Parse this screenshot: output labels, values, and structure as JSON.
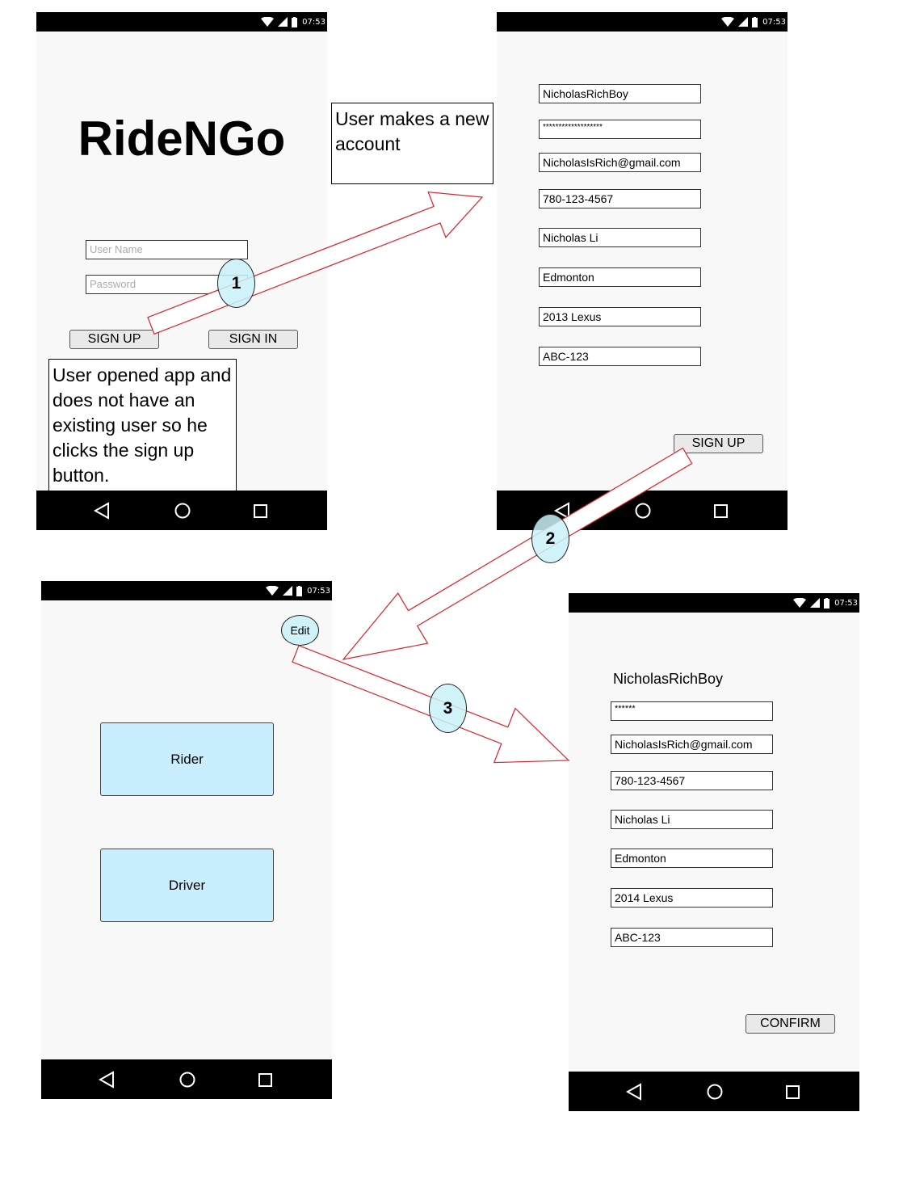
{
  "status": {
    "time": "07:53"
  },
  "screen1": {
    "app_title": "RideNGo",
    "username_placeholder": "User Name",
    "password_placeholder": "Password",
    "signup_label": "SIGN UP",
    "signin_label": "SIGN IN"
  },
  "screen2": {
    "fields": [
      "NicholasRichBoy",
      "*******************",
      "NicholasIsRich@gmail.com",
      "780-123-4567",
      "Nicholas Li",
      "Edmonton",
      "2013 Lexus",
      "ABC-123"
    ],
    "signup_label": "SIGN UP"
  },
  "screen3": {
    "edit_label": "Edit",
    "rider_label": "Rider",
    "driver_label": "Driver"
  },
  "screen4": {
    "username": "NicholasRichBoy",
    "fields": [
      "******",
      "NicholasIsRich@gmail.com",
      "780-123-4567",
      "Nicholas Li",
      "Edmonton",
      "2014 Lexus",
      "ABC-123"
    ],
    "confirm_label": "CONFIRM"
  },
  "notes": {
    "note1": "User opened app and does not have an existing user so he clicks the sign up button.",
    "note2": "User makes a new account"
  },
  "steps": [
    "1",
    "2",
    "3"
  ],
  "colors": {
    "arrow_stroke": "#e0202a",
    "step_fill": "#c8f2f8",
    "role_button_fill": "#c9efff",
    "phone_bg": "#f8f8f8"
  }
}
